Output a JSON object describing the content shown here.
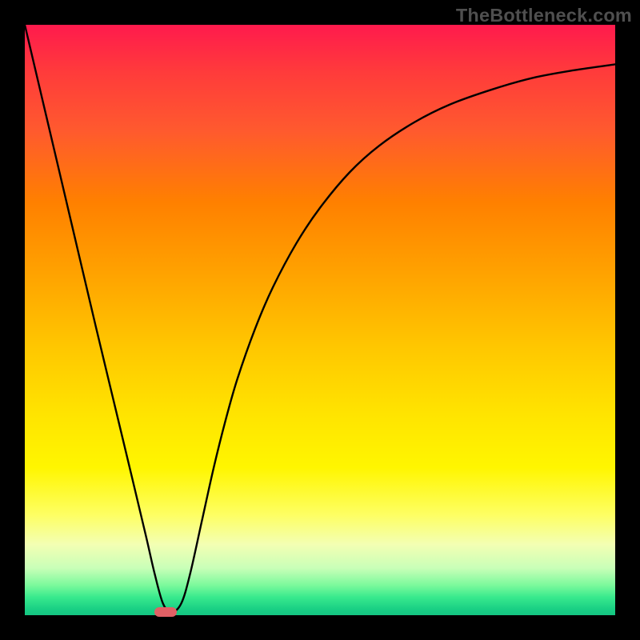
{
  "watermark": "TheBottleneck.com",
  "chart_data": {
    "type": "line",
    "title": "",
    "xlabel": "",
    "ylabel": "",
    "xlim": [
      0,
      100
    ],
    "ylim": [
      0,
      100
    ],
    "grid": false,
    "series": [
      {
        "name": "bottleneck-curve",
        "x": [
          0,
          4,
          8,
          12,
          15,
          18,
          20.5,
          22,
          23.4,
          24.8,
          26.5,
          28,
          30,
          32,
          34,
          36,
          39,
          42,
          46,
          50,
          55,
          60,
          66,
          72,
          79,
          86,
          93,
          100
        ],
        "y": [
          100,
          83,
          66,
          49,
          36.5,
          24,
          13.5,
          7,
          2,
          0.5,
          2,
          7,
          16,
          25,
          33,
          40,
          48.5,
          55.5,
          63,
          69,
          75,
          79.5,
          83.5,
          86.5,
          89,
          91,
          92.3,
          93.3
        ]
      }
    ],
    "minimum_marker": {
      "x": 23.8,
      "y": 0.6
    },
    "gradient_stops": [
      {
        "pos": 0,
        "color": "#ff1a4d"
      },
      {
        "pos": 8,
        "color": "#ff3b3b"
      },
      {
        "pos": 18,
        "color": "#ff5a2e"
      },
      {
        "pos": 30,
        "color": "#ff8000"
      },
      {
        "pos": 42,
        "color": "#ffa200"
      },
      {
        "pos": 55,
        "color": "#ffc800"
      },
      {
        "pos": 66,
        "color": "#ffe400"
      },
      {
        "pos": 75,
        "color": "#fff600"
      },
      {
        "pos": 83,
        "color": "#feff63"
      },
      {
        "pos": 88,
        "color": "#f3ffb3"
      },
      {
        "pos": 92,
        "color": "#c9ffb8"
      },
      {
        "pos": 95,
        "color": "#79f99b"
      },
      {
        "pos": 97,
        "color": "#37e98d"
      },
      {
        "pos": 99,
        "color": "#19cf84"
      },
      {
        "pos": 100,
        "color": "#15c582"
      }
    ],
    "frame": {
      "border_px": 31,
      "inner_width": 738,
      "inner_height": 738,
      "border_color": "#000000"
    }
  }
}
